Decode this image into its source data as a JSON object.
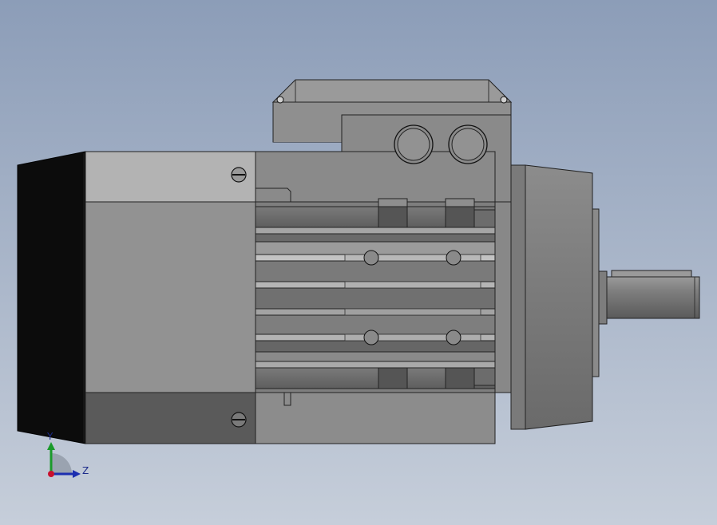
{
  "viewport": {
    "background_top": "#8c9db8",
    "background_bottom": "#c6ceda"
  },
  "triad": {
    "y_label": "Y",
    "z_label": "Z",
    "y_color": "#1a9a2a",
    "z_color": "#1c2fb0",
    "origin_color": "#c8102e"
  }
}
